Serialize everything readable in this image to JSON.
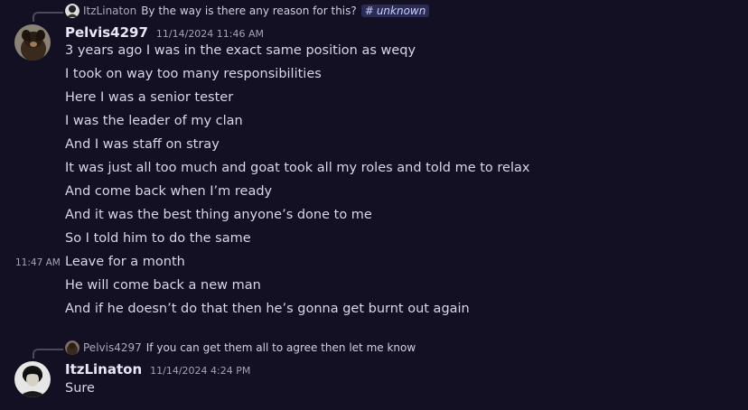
{
  "reply1": {
    "author": "ItzLinaton",
    "text": "By the way is there any reason for this?",
    "channel_tag": "unknown"
  },
  "message1": {
    "author": "Pelvis4297",
    "timestamp": "11/14/2024 11:46 AM",
    "lines": [
      "3 years ago I was in the exact same position as weqy",
      "I took on way too many responsibilities",
      "Here I was a senior tester",
      "I was the leader of my clan",
      "And I was staff on stray",
      "It was just all too much and goat took all my roles and told me to relax",
      "And come back when I’m ready",
      "And it was the best thing anyone’s done to me",
      "So I told him to do the same",
      "Leave for a month",
      "He will come back a new man",
      "And if he doesn’t do that then he’s gonna get burnt out again"
    ],
    "hover_time": "11:47 AM"
  },
  "reply2": {
    "author": "Pelvis4297",
    "text": "If you can get them all to agree then let me know"
  },
  "message2": {
    "author": "ItzLinaton",
    "timestamp": "11/14/2024 4:24 PM",
    "lines": [
      "Sure"
    ]
  }
}
